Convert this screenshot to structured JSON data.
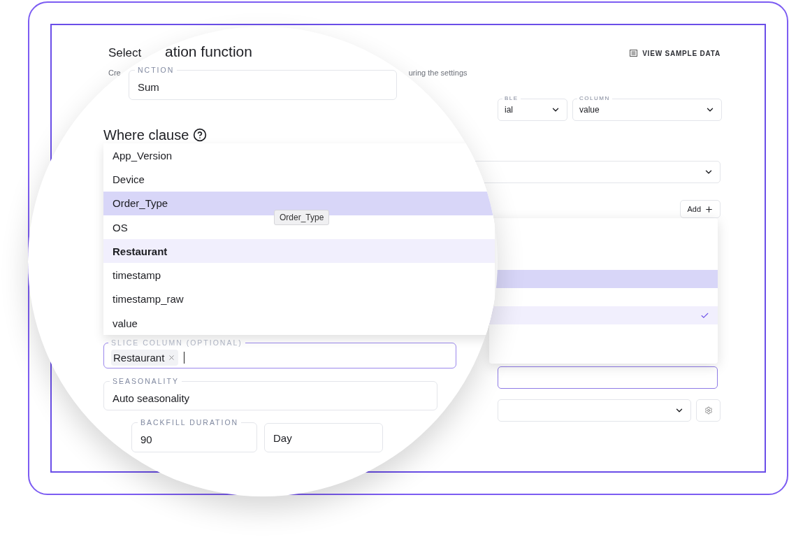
{
  "header": {
    "title_fragment": "Select",
    "subtitle_fragment_left": "Cre",
    "subtitle_fragment_right": "uring the settings",
    "action": "VIEW SAMPLE DATA"
  },
  "source": {
    "table": {
      "label": "BLE",
      "value": "ial"
    },
    "column": {
      "label": "COLUMN",
      "value": "value"
    }
  },
  "add_button": "Add",
  "background_options": [
    {
      "hovered": false,
      "selected": false
    },
    {
      "hovered": true,
      "selected": false
    },
    {
      "hovered": false,
      "selected": false
    },
    {
      "hovered": false,
      "selected": true
    }
  ],
  "magnifier": {
    "heading_fragment": "ation function",
    "function_field": {
      "label": "NCTION",
      "value": "Sum"
    },
    "where_heading": "Where clause",
    "options": [
      {
        "label": "App_Version",
        "hovered": false,
        "selected": false
      },
      {
        "label": "Device",
        "hovered": false,
        "selected": false
      },
      {
        "label": "Order_Type",
        "hovered": true,
        "selected": false
      },
      {
        "label": "OS",
        "hovered": false,
        "selected": false
      },
      {
        "label": "Restaurant",
        "hovered": false,
        "selected": true
      },
      {
        "label": "timestamp",
        "hovered": false,
        "selected": false
      },
      {
        "label": "timestamp_raw",
        "hovered": false,
        "selected": false
      },
      {
        "label": "value",
        "hovered": false,
        "selected": false
      }
    ],
    "tooltip": "Order_Type",
    "slice_field": {
      "label": "SLICE COLUMN (OPTIONAL)",
      "chips": [
        "Restaurant"
      ],
      "focused": true
    },
    "seasonality": {
      "label": "SEASONALITY",
      "value": "Auto seasonality"
    },
    "backfill": {
      "label": "BACKFILL DURATION",
      "amount": "90",
      "unit": "Day"
    }
  }
}
